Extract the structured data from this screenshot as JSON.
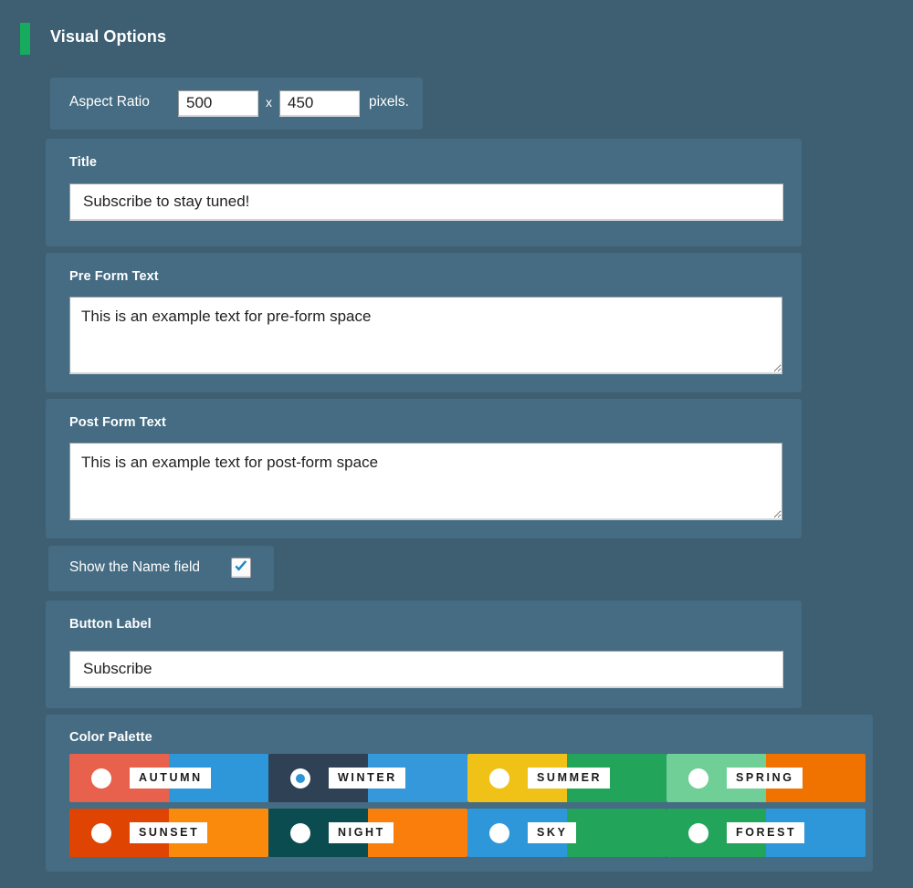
{
  "header": {
    "title": "Visual Options",
    "accent_color": "#17ab5d"
  },
  "aspect_ratio": {
    "label": "Aspect Ratio",
    "width_value": "500",
    "separator": "x",
    "height_value": "450",
    "suffix": "pixels."
  },
  "title_field": {
    "label": "Title",
    "value": "Subscribe to stay tuned!"
  },
  "pre_form_text": {
    "label": "Pre Form Text",
    "value": "This is an example text for pre-form space"
  },
  "post_form_text": {
    "label": "Post Form Text",
    "value": "This is an example text for post-form space"
  },
  "show_name_field": {
    "label": "Show the Name field",
    "checked": true
  },
  "button_label_field": {
    "label": "Button Label",
    "value": "Subscribe"
  },
  "color_palette": {
    "label": "Color Palette",
    "selected": "WINTER",
    "options": [
      {
        "name": "AUTUMN",
        "left": "#e8614d",
        "right": "#2e97da",
        "selected": false
      },
      {
        "name": "WINTER",
        "left": "#2f4255",
        "right": "#3498db",
        "selected": true
      },
      {
        "name": "SUMMER",
        "left": "#f0c117",
        "right": "#23a45b",
        "selected": false
      },
      {
        "name": "SPRING",
        "left": "#6fcf97",
        "right": "#f07300",
        "selected": false
      },
      {
        "name": "SUNSET",
        "left": "#e04403",
        "right": "#fa8a0b",
        "selected": false
      },
      {
        "name": "NIGHT",
        "left": "#0a4c50",
        "right": "#fa7e0b",
        "selected": false
      },
      {
        "name": "SKY",
        "left": "#2e97da",
        "right": "#23a45b",
        "selected": false
      },
      {
        "name": "FOREST",
        "left": "#23a45b",
        "right": "#2e97da",
        "selected": false
      }
    ]
  },
  "theme": {
    "background": "#3e5e72",
    "panel": "#456c83",
    "text": "#ffffff"
  }
}
